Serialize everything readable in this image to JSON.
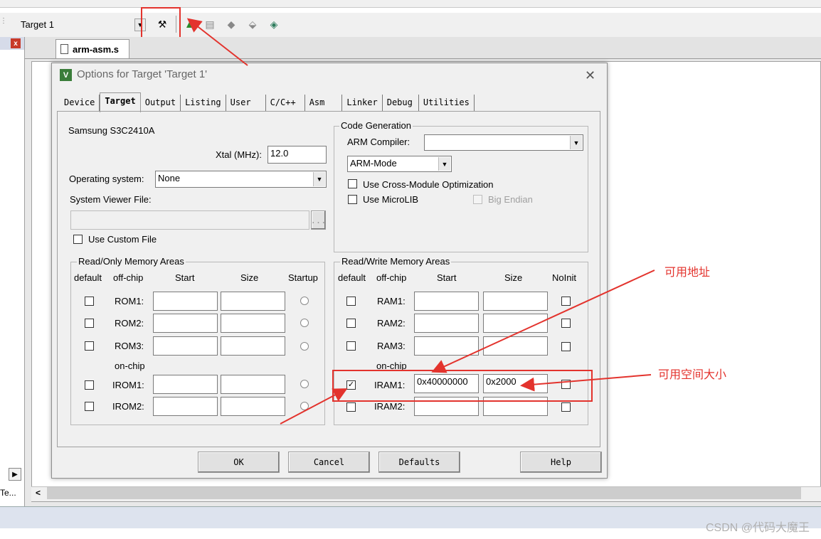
{
  "toolbar": {
    "target_combo": "Target 1",
    "options_icon": "magic-wand-icon",
    "icons": [
      "build-icon",
      "stack-icon",
      "diamond-icon",
      "download-icon",
      "load-icon"
    ]
  },
  "editor": {
    "file_tab": "arm-asm.s",
    "left_pane_tab": "Te...",
    "scroll_left": "<"
  },
  "dialog": {
    "title": "Options for Target 'Target 1'",
    "close": "✕",
    "tabs": [
      "Device",
      "Target",
      "Output",
      "Listing",
      "User",
      "C/C++",
      "Asm",
      "Linker",
      "Debug",
      "Utilities"
    ],
    "active_tab": "Target",
    "device": "Samsung S3C2410A",
    "xtal_label": "Xtal (MHz):",
    "xtal_value": "12.0",
    "os_label": "Operating system:",
    "os_value": "None",
    "svf_label": "System Viewer File:",
    "svf_browse": "...",
    "use_custom_file": "Use Custom File",
    "codegen": {
      "title": "Code Generation",
      "compiler_label": "ARM Compiler:",
      "compiler_value": "",
      "mode_value": "ARM-Mode",
      "cross_module": "Use Cross-Module Optimization",
      "microlib": "Use MicroLIB",
      "big_endian": "Big Endian"
    },
    "ro": {
      "title": "Read/Only Memory Areas",
      "headers": [
        "default",
        "off-chip",
        "Start",
        "Size",
        "Startup"
      ],
      "offchip_rows": [
        "ROM1:",
        "ROM2:",
        "ROM3:"
      ],
      "onchip_label": "on-chip",
      "onchip_rows": [
        "IROM1:",
        "IROM2:"
      ]
    },
    "rw": {
      "title": "Read/Write Memory Areas",
      "headers": [
        "default",
        "off-chip",
        "Start",
        "Size",
        "NoInit"
      ],
      "offchip_rows": [
        "RAM1:",
        "RAM2:",
        "RAM3:"
      ],
      "onchip_label": "on-chip",
      "iram1_label": "IRAM1:",
      "iram1_start": "0x40000000",
      "iram1_size": "0x2000",
      "iram2_label": "IRAM2:"
    },
    "buttons": {
      "ok": "OK",
      "cancel": "Cancel",
      "defaults": "Defaults",
      "help": "Help"
    }
  },
  "annotations": {
    "address_label": "可用地址",
    "size_label": "可用空间大小",
    "color": "#e3332d"
  },
  "watermark": "CSDN @代码大魔王"
}
